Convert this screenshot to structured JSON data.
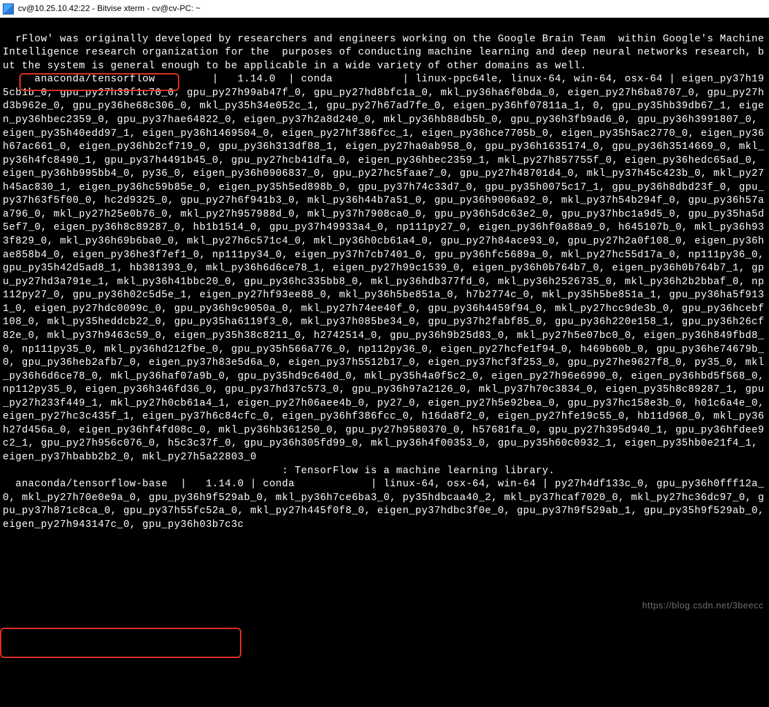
{
  "window": {
    "title": "cv@10.25.10.42:22 - Bitvise xterm - cv@cv-PC: ~"
  },
  "highlights": {
    "box1_label": "anaconda/tensorflow",
    "box2_label": "anaconda/tensorflow-base"
  },
  "terminal_text": "rFlow' was originally developed by researchers and engineers working on the Google Brain Team  within Google's Machine Intelligence research organization for the  purposes of conducting machine learning and deep neural networks research, but the system is general enough to be applicable in a wide variety of other domains as well.\n     anaconda/tensorflow         |   1.14.0  | conda           | linux-ppc64le, linux-64, win-64, osx-64 | eigen_py37h195cb1b_0, gpu_py27h39f1c70_0, gpu_py27h99ab47f_0, gpu_py27hd8bfc1a_0, mkl_py36ha6f0bda_0, eigen_py27h6ba8707_0, gpu_py27hd3b962e_0, gpu_py36he68c306_0, mkl_py35h34e052c_1, gpu_py27h67ad7fe_0, eigen_py36hf07811a_1, 0, gpu_py35hb39db67_1, eigen_py36hbec2359_0, gpu_py37hae64822_0, eigen_py37h2a8d240_0, mkl_py36hb88db5b_0, gpu_py36h3fb9ad6_0, gpu_py36h3991807_0, eigen_py35h40edd97_1, eigen_py36h1469504_0, eigen_py27hf386fcc_1, eigen_py36hce7705b_0, eigen_py35h5ac2770_0, eigen_py36h67ac661_0, eigen_py36hb2cf719_0, gpu_py36h313df88_1, eigen_py27ha0ab958_0, gpu_py36h1635174_0, gpu_py36h3514669_0, mkl_py36h4fc8490_1, gpu_py37h4491b45_0, gpu_py27hcb41dfa_0, eigen_py36hbec2359_1, mkl_py27h857755f_0, eigen_py36hedc65ad_0, eigen_py36hb995bb4_0, py36_0, eigen_py36h0906837_0, gpu_py27hc5faae7_0, gpu_py27h48701d4_0, mkl_py37h45c423b_0, mkl_py27h45ac830_1, eigen_py36hc59b85e_0, eigen_py35h5ed898b_0, gpu_py37h74c33d7_0, gpu_py35h0075c17_1, gpu_py36h8dbd23f_0, gpu_py37h63f5f00_0, hc2d9325_0, gpu_py27h6f941b3_0, mkl_py36h44b7a51_0, gpu_py36h9006a92_0, mkl_py37h54b294f_0, gpu_py36h57aa796_0, mkl_py27h25e0b76_0, mkl_py27h957988d_0, mkl_py37h7908ca0_0, gpu_py36h5dc63e2_0, gpu_py37hbc1a9d5_0, gpu_py35ha5d5ef7_0, eigen_py36h8c89287_0, hb1b1514_0, gpu_py37h49933a4_0, np111py27_0, eigen_py36hf0a88a9_0, h645107b_0, mkl_py36h933f829_0, mkl_py36h69b6ba0_0, mkl_py27h6c571c4_0, mkl_py36h0cb61a4_0, gpu_py27h84ace93_0, gpu_py27h2a0f108_0, eigen_py36hae858b4_0, eigen_py36he3f7ef1_0, np111py34_0, eigen_py37h7cb7401_0, gpu_py36hfc5689a_0, mkl_py27hc55d17a_0, np111py36_0, gpu_py35h42d5ad8_1, hb381393_0, mkl_py36h6d6ce78_1, eigen_py27h99c1539_0, eigen_py36h0b764b7_0, eigen_py36h0b764b7_1, gpu_py27hd3a791e_1, mkl_py36h41bbc20_0, gpu_py36hc335bb8_0, mkl_py36hdb377fd_0, mkl_py36h2526735_0, mkl_py36h2b2bbaf_0, np112py27_0, gpu_py36h02c5d5e_1, eigen_py27hf93ee88_0, mkl_py36h5be851a_0, h7b2774c_0, mkl_py35h5be851a_1, gpu_py36ha5f9131_0, eigen_py27hdc0099c_0, gpu_py36h9c9050a_0, mkl_py27h74ee40f_0, gpu_py36h4459f94_0, mkl_py27hcc9de3b_0, gpu_py36hcebf108_0, mkl_py35heddcb22_0, gpu_py35ha6119f3_0, mkl_py37h085be34_0, gpu_py37h2fabf85_0, gpu_py36h220e158_1, gpu_py36h26cf82e_0, mkl_py37h9463c59_0, eigen_py35h38c8211_0, h2742514_0, gpu_py36h9b25d83_0, mkl_py27h5e07bc0_0, eigen_py36h849fbd8_0, np111py35_0, mkl_py36hd212fbe_0, gpu_py35h566a776_0, np112py36_0, eigen_py27hcfe1f94_0, h469b60b_0, gpu_py36he74679b_0, gpu_py36heb2afb7_0, eigen_py37h83e5d6a_0, eigen_py37h5512b17_0, eigen_py37hcf3f253_0, gpu_py27he9627f8_0, py35_0, mkl_py36h6d6ce78_0, mkl_py36haf07a9b_0, gpu_py35hd9c640d_0, mkl_py35h4a0f5c2_0, eigen_py27h96e6990_0, eigen_py36hbd5f568_0, np112py35_0, eigen_py36h346fd36_0, gpu_py37hd37c573_0, gpu_py36h97a2126_0, mkl_py37h70c3834_0, eigen_py35h8c89287_1, gpu_py27h233f449_1, mkl_py27h0cb61a4_1, eigen_py27h06aee4b_0, py27_0, eigen_py27h5e92bea_0, gpu_py37hc158e3b_0, h01c6a4e_0, eigen_py27hc3c435f_1, eigen_py37h6c84cfc_0, eigen_py36hf386fcc_0, h16da8f2_0, eigen_py27hfe19c55_0, hb11d968_0, mkl_py36h27d456a_0, eigen_py36hf4fd08c_0, mkl_py36hb361250_0, gpu_py27h9580370_0, h57681fa_0, gpu_py27h395d940_1, gpu_py36hfdee9c2_1, gpu_py27h956c076_0, h5c3c37f_0, gpu_py36h305fd99_0, mkl_py36h4f00353_0, gpu_py35h60c0932_1, eigen_py35hb0e21f4_1, eigen_py37hbabb2b2_0, mkl_py27h5a22803_0\n                                            : TensorFlow is a machine learning library.\n  anaconda/tensorflow-base  |   1.14.0 | conda            | linux-64, osx-64, win-64 | py27h4df133c_0, gpu_py36h0fff12a_0, mkl_py27h70e0e9a_0, gpu_py36h9f529ab_0, mkl_py36h7ce6ba3_0, py35hdbcaa40_2, mkl_py37hcaf7020_0, mkl_py27hc36dc97_0, gpu_py37h871c8ca_0, gpu_py37h55fc52a_0, mkl_py27h445f0f8_0, eigen_py37hdbc3f0e_0, gpu_py37h9f529ab_1, gpu_py35h9f529ab_0, eigen_py27h943147c_0, gpu_py36h03b7c3c",
  "watermark": "https://blog.csdn.net/3beecc"
}
